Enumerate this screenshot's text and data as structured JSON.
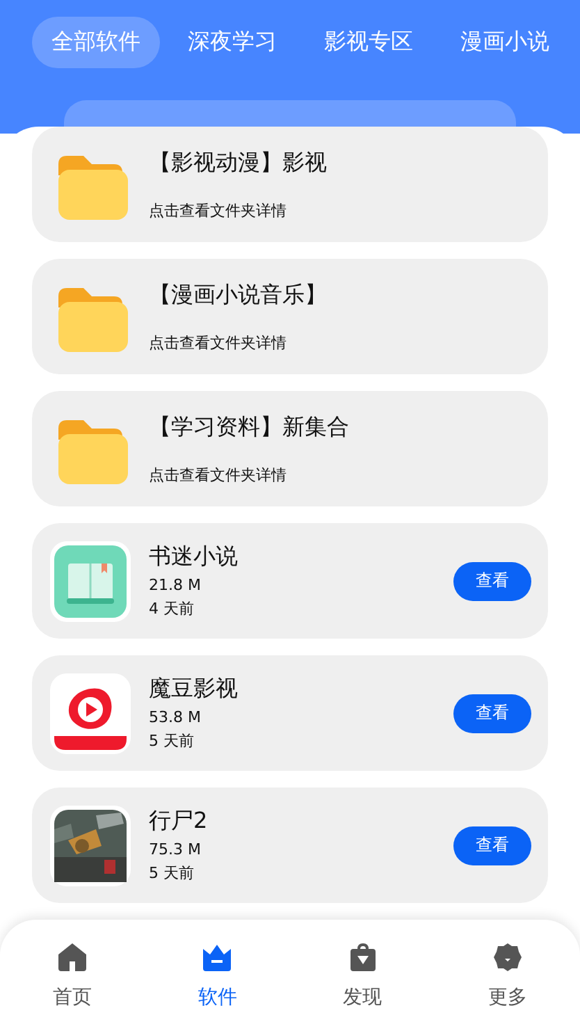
{
  "tabs": [
    {
      "label": "全部软件",
      "selected": true
    },
    {
      "label": "深夜学习",
      "selected": false
    },
    {
      "label": "影视专区",
      "selected": false
    },
    {
      "label": "漫画小说",
      "selected": false
    }
  ],
  "items": [
    {
      "kind": "folder",
      "title": "【影视动漫】影视",
      "subtitle": "点击查看文件夹详情"
    },
    {
      "kind": "folder",
      "title": "【漫画小说音乐】",
      "subtitle": "点击查看文件夹详情"
    },
    {
      "kind": "folder",
      "title": "【学习资料】新集合",
      "subtitle": "点击查看文件夹详情"
    },
    {
      "kind": "app",
      "title": "书迷小说",
      "size": "21.8 M",
      "time": "4 天前",
      "button": "查看"
    },
    {
      "kind": "app",
      "title": "魔豆影视",
      "size": "53.8 M",
      "time": "5 天前",
      "button": "查看"
    },
    {
      "kind": "app",
      "title": "行尸2",
      "size": "75.3 M",
      "time": "5 天前",
      "button": "查看"
    }
  ],
  "nav": [
    {
      "label": "首页",
      "selected": false
    },
    {
      "label": "软件",
      "selected": true
    },
    {
      "label": "发现",
      "selected": false
    },
    {
      "label": "更多",
      "selected": false
    }
  ]
}
